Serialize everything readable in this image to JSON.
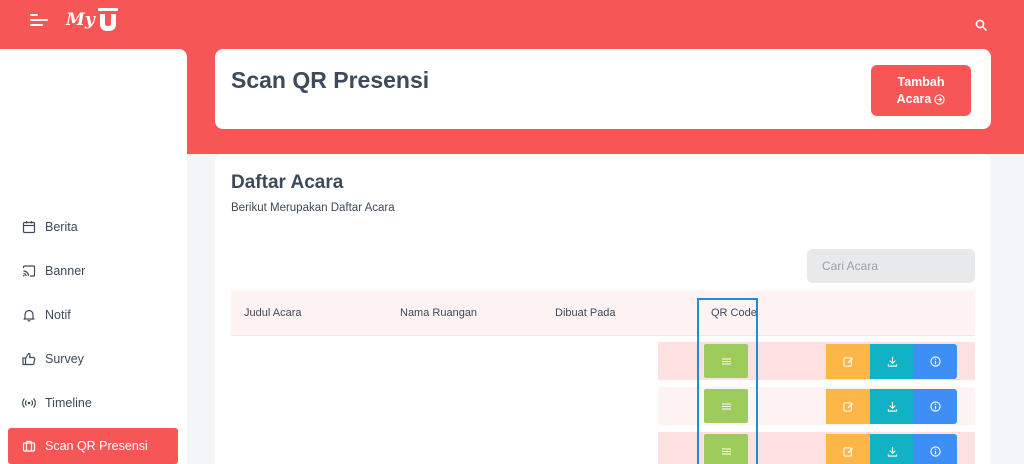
{
  "app": {
    "logo_text": "My",
    "icons": {
      "menu": "hamburger-icon",
      "search": "search-icon",
      "logo": "logo-mark-icon"
    }
  },
  "sidebar": {
    "items": [
      {
        "label": "Berita",
        "icon": "calendar-icon",
        "active": false
      },
      {
        "label": "Banner",
        "icon": "cast-icon",
        "active": false
      },
      {
        "label": "Notif",
        "icon": "bell-icon",
        "active": false
      },
      {
        "label": "Survey",
        "icon": "thumbs-up-icon",
        "active": false
      },
      {
        "label": "Timeline",
        "icon": "broadcast-icon",
        "active": false
      },
      {
        "label": "Scan QR Presensi",
        "icon": "briefcase-icon",
        "active": true
      }
    ]
  },
  "header": {
    "title": "Scan QR Presensi",
    "add_button": {
      "line1": "Tambah",
      "line2": "Acara",
      "icon": "arrow-right-circle-icon"
    }
  },
  "list": {
    "title": "Daftar Acara",
    "subtitle": "Berikut Merupakan Daftar Acara",
    "search_placeholder": "Cari Acara",
    "columns": [
      "Judul Acara",
      "Nama Ruangan",
      "Dibuat Pada",
      "QR Code"
    ],
    "rows": [
      {
        "judul": "",
        "ruangan": "",
        "dibuat": "",
        "qr_icon": "menu-lines-icon"
      },
      {
        "judul": "",
        "ruangan": "",
        "dibuat": "",
        "qr_icon": "menu-lines-icon"
      },
      {
        "judul": "",
        "ruangan": "",
        "dibuat": "",
        "qr_icon": "menu-lines-icon"
      }
    ],
    "row_actions": [
      "edit-icon",
      "download-icon",
      "info-icon"
    ]
  },
  "colors": {
    "brand": "#f75656",
    "qr_button": "#9dcc5c",
    "edit_button": "#ffb648",
    "download_button": "#12b2c6",
    "info_button": "#3d8ff5",
    "highlight": "#1a8fd6"
  }
}
